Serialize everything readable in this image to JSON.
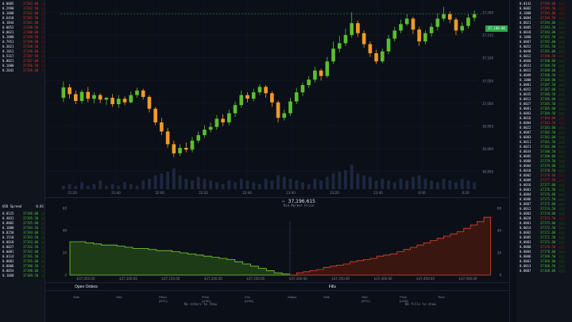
{
  "chart": {
    "price_label": "37,188.00",
    "price_axis": [
      "37,200",
      "37,150",
      "37,100",
      "37,050",
      "37,000",
      "36,950",
      "36,900",
      "36,850"
    ],
    "time_axis": [
      "21:20",
      "21:40",
      "22:00",
      "22:20",
      "22:40",
      "23:00",
      "23:20",
      "23:40",
      "0:00",
      "0:20"
    ],
    "candles": [
      {
        "o": 37012,
        "c": 37035,
        "h": 37048,
        "l": 37003
      },
      {
        "o": 37035,
        "c": 37020,
        "h": 37042,
        "l": 37010
      },
      {
        "o": 37020,
        "c": 37005,
        "h": 37028,
        "l": 36998
      },
      {
        "o": 37005,
        "c": 37025,
        "h": 37030,
        "l": 37000
      },
      {
        "o": 37025,
        "c": 37010,
        "h": 37036,
        "l": 37002
      },
      {
        "o": 37010,
        "c": 37018,
        "h": 37024,
        "l": 37000
      },
      {
        "o": 37018,
        "c": 37008,
        "h": 37022,
        "l": 37000
      },
      {
        "o": 37008,
        "c": 37012,
        "h": 37014,
        "l": 36996
      },
      {
        "o": 37012,
        "c": 36998,
        "h": 37020,
        "l": 36992
      },
      {
        "o": 36998,
        "c": 37010,
        "h": 37018,
        "l": 36990
      },
      {
        "o": 37010,
        "c": 37002,
        "h": 37015,
        "l": 36996
      },
      {
        "o": 37002,
        "c": 37018,
        "h": 37026,
        "l": 37000
      },
      {
        "o": 37018,
        "c": 37028,
        "h": 37034,
        "l": 37012
      },
      {
        "o": 37028,
        "c": 37014,
        "h": 37032,
        "l": 37008
      },
      {
        "o": 37014,
        "c": 36988,
        "h": 37018,
        "l": 36980
      },
      {
        "o": 36988,
        "c": 36958,
        "h": 36992,
        "l": 36952
      },
      {
        "o": 36958,
        "c": 36938,
        "h": 36968,
        "l": 36930
      },
      {
        "o": 36938,
        "c": 36910,
        "h": 36946,
        "l": 36902
      },
      {
        "o": 36910,
        "c": 36890,
        "h": 36918,
        "l": 36882
      },
      {
        "o": 36890,
        "c": 36902,
        "h": 36910,
        "l": 36884
      },
      {
        "o": 36902,
        "c": 36898,
        "h": 36914,
        "l": 36892
      },
      {
        "o": 36898,
        "c": 36918,
        "h": 36926,
        "l": 36892
      },
      {
        "o": 36918,
        "c": 36930,
        "h": 36938,
        "l": 36912
      },
      {
        "o": 36930,
        "c": 36942,
        "h": 36952,
        "l": 36924
      },
      {
        "o": 36942,
        "c": 36948,
        "h": 36958,
        "l": 36936
      },
      {
        "o": 36948,
        "c": 36966,
        "h": 36974,
        "l": 36942
      },
      {
        "o": 36966,
        "c": 36958,
        "h": 36976,
        "l": 36950
      },
      {
        "o": 36958,
        "c": 36978,
        "h": 36986,
        "l": 36952
      },
      {
        "o": 36978,
        "c": 36996,
        "h": 37004,
        "l": 36970
      },
      {
        "o": 36996,
        "c": 37018,
        "h": 37028,
        "l": 36990
      },
      {
        "o": 37018,
        "c": 37010,
        "h": 37024,
        "l": 37002
      },
      {
        "o": 37010,
        "c": 37024,
        "h": 37032,
        "l": 37004
      },
      {
        "o": 37024,
        "c": 37036,
        "h": 37042,
        "l": 37018
      },
      {
        "o": 37036,
        "c": 37022,
        "h": 37040,
        "l": 37012
      },
      {
        "o": 37022,
        "c": 37002,
        "h": 37026,
        "l": 36992
      },
      {
        "o": 37002,
        "c": 36968,
        "h": 37006,
        "l": 36958
      },
      {
        "o": 36968,
        "c": 36978,
        "h": 36986,
        "l": 36962
      },
      {
        "o": 36978,
        "c": 37004,
        "h": 37012,
        "l": 36972
      },
      {
        "o": 37004,
        "c": 37024,
        "h": 37034,
        "l": 36998
      },
      {
        "o": 37024,
        "c": 37040,
        "h": 37046,
        "l": 37016
      },
      {
        "o": 37040,
        "c": 37052,
        "h": 37060,
        "l": 37034
      },
      {
        "o": 37052,
        "c": 37072,
        "h": 37080,
        "l": 37046
      },
      {
        "o": 37072,
        "c": 37060,
        "h": 37076,
        "l": 37050
      },
      {
        "o": 37060,
        "c": 37092,
        "h": 37102,
        "l": 37056
      },
      {
        "o": 37092,
        "c": 37120,
        "h": 37136,
        "l": 37086
      },
      {
        "o": 37120,
        "c": 37132,
        "h": 37148,
        "l": 37112
      },
      {
        "o": 37132,
        "c": 37150,
        "h": 37164,
        "l": 37126
      },
      {
        "o": 37150,
        "c": 37176,
        "h": 37200,
        "l": 37144
      },
      {
        "o": 37176,
        "c": 37154,
        "h": 37182,
        "l": 37146
      },
      {
        "o": 37154,
        "c": 37130,
        "h": 37160,
        "l": 37122
      },
      {
        "o": 37130,
        "c": 37110,
        "h": 37136,
        "l": 37102
      },
      {
        "o": 37110,
        "c": 37092,
        "h": 37118,
        "l": 37086
      },
      {
        "o": 37092,
        "c": 37114,
        "h": 37120,
        "l": 37088
      },
      {
        "o": 37114,
        "c": 37142,
        "h": 37150,
        "l": 37108
      },
      {
        "o": 37142,
        "c": 37160,
        "h": 37168,
        "l": 37136
      },
      {
        "o": 37160,
        "c": 37174,
        "h": 37184,
        "l": 37154
      },
      {
        "o": 37174,
        "c": 37186,
        "h": 37196,
        "l": 37170
      },
      {
        "o": 37186,
        "c": 37162,
        "h": 37190,
        "l": 37152
      },
      {
        "o": 37162,
        "c": 37136,
        "h": 37168,
        "l": 37126
      },
      {
        "o": 37136,
        "c": 37154,
        "h": 37160,
        "l": 37130
      },
      {
        "o": 37154,
        "c": 37168,
        "h": 37176,
        "l": 37146
      },
      {
        "o": 37168,
        "c": 37186,
        "h": 37198,
        "l": 37160
      },
      {
        "o": 37186,
        "c": 37196,
        "h": 37212,
        "l": 37180
      },
      {
        "o": 37196,
        "c": 37184,
        "h": 37202,
        "l": 37176
      },
      {
        "o": 37184,
        "c": 37160,
        "h": 37188,
        "l": 37150
      },
      {
        "o": 37160,
        "c": 37170,
        "h": 37178,
        "l": 37154
      },
      {
        "o": 37170,
        "c": 37188,
        "h": 37196,
        "l": 37164
      },
      {
        "o": 37188,
        "c": 37196,
        "h": 37204,
        "l": 37180
      }
    ],
    "volumes": [
      2,
      3,
      2,
      4,
      2,
      3,
      5,
      2,
      3,
      2,
      4,
      3,
      2,
      5,
      6,
      8,
      9,
      10,
      12,
      8,
      6,
      5,
      7,
      6,
      5,
      4,
      3,
      5,
      4,
      6,
      5,
      4,
      3,
      6,
      5,
      8,
      7,
      6,
      5,
      4,
      3,
      6,
      5,
      7,
      9,
      10,
      11,
      14,
      9,
      8,
      7,
      5,
      6,
      5,
      4,
      6,
      5,
      7,
      8,
      6,
      5,
      4,
      6,
      5,
      4,
      6,
      5,
      4
    ]
  },
  "depth": {
    "mid_price": "37,196.615",
    "mid_label": "Mid Market Price",
    "x_ticks": [
      "$37,050.00",
      "$37,100.00",
      "$37,150.00",
      "$37,200.00",
      "$37,250.00",
      "$37,300.00",
      "$37,350.00",
      "$37,400.00",
      "$37,450.00",
      "$37,500.00"
    ],
    "y_left": [
      "60",
      "40",
      "20",
      "0"
    ],
    "y_right": [
      "60",
      "40",
      "20",
      "0"
    ],
    "bids": [
      30,
      30,
      29,
      28,
      27,
      27,
      26,
      25,
      24,
      24,
      23,
      22,
      22,
      21,
      20,
      19,
      18,
      17,
      16,
      15,
      14,
      12,
      10,
      8,
      6,
      4,
      2,
      1,
      0
    ],
    "asks": [
      0,
      2,
      3,
      4,
      5,
      7,
      8,
      9,
      10,
      12,
      13,
      14,
      15,
      17,
      18,
      19,
      21,
      23,
      25,
      27,
      29,
      31,
      33,
      35,
      37,
      39,
      42,
      45,
      48,
      52
    ]
  },
  "orders": {
    "left_title": "Open Orders",
    "right_title": "Fills",
    "left_headers": [
      "Side",
      "Size",
      "Filled (BTC)",
      "Price (USD)",
      "Fee (USD)",
      "Status"
    ],
    "right_headers": [
      "Side",
      "Size (BTC)",
      "Price (USD)",
      "Time"
    ],
    "left_empty": "No orders to show",
    "right_empty": "No fills to show"
  },
  "left_orderbook": {
    "usd_label": "USD Spread",
    "usd_value": "0.01",
    "asks": [
      {
        "size": "0.0005",
        "price": "37203.00"
      },
      {
        "size": "0.2990",
        "price": "37202.50"
      },
      {
        "size": "0.1000",
        "price": "37202.00"
      },
      {
        "size": "0.6410",
        "price": "37201.50"
      },
      {
        "size": "0.1844",
        "price": "37201.00"
      },
      {
        "size": "0.0052",
        "price": "37200.50"
      },
      {
        "size": "0.0021",
        "price": "37200.00"
      },
      {
        "size": "0.1000",
        "price": "37199.50"
      },
      {
        "size": "0.7951",
        "price": "37199.00"
      },
      {
        "size": "0.3021",
        "price": "37198.50"
      },
      {
        "size": "0.1011",
        "price": "37198.00"
      },
      {
        "size": "0.5317",
        "price": "37197.50"
      },
      {
        "size": "0.0021",
        "price": "37197.00"
      },
      {
        "size": "0.1000",
        "price": "37196.50"
      },
      {
        "size": "0.2042",
        "price": "37196.00"
      }
    ],
    "bids": [
      {
        "size": "0.0125",
        "price": "37196.00"
      },
      {
        "size": "0.4031",
        "price": "37195.50"
      },
      {
        "size": "0.0002",
        "price": "37195.00"
      },
      {
        "size": "0.1000",
        "price": "37194.50"
      },
      {
        "size": "0.0258",
        "price": "37194.00"
      },
      {
        "size": "0.1510",
        "price": "37193.50"
      },
      {
        "size": "0.0010",
        "price": "37193.00"
      },
      {
        "size": "0.0027",
        "price": "37192.50"
      },
      {
        "size": "0.0001",
        "price": "37192.00"
      },
      {
        "size": "0.0114",
        "price": "37191.50"
      },
      {
        "size": "0.0003",
        "price": "37191.00"
      },
      {
        "size": "0.0006",
        "price": "37190.50"
      },
      {
        "size": "0.0054",
        "price": "37190.00"
      },
      {
        "size": "0.1060",
        "price": "37189.50"
      }
    ]
  },
  "right_orderbook": {
    "rows": [
      {
        "size": "0.0143",
        "price": "37196.00",
        "c": "red"
      },
      {
        "size": "0.0002",
        "price": "37195.50",
        "c": "red"
      },
      {
        "size": "0.1000",
        "price": "37195.00",
        "c": "red"
      },
      {
        "size": "0.0004",
        "price": "37194.50",
        "c": "red"
      },
      {
        "size": "0.0021",
        "price": "37194.00",
        "c": "green"
      },
      {
        "size": "0.0005",
        "price": "37193.50",
        "c": "green"
      },
      {
        "size": "0.0018",
        "price": "37193.00",
        "c": "green"
      },
      {
        "size": "0.1000",
        "price": "37192.50",
        "c": "green"
      },
      {
        "size": "0.0007",
        "price": "37192.00",
        "c": "green"
      },
      {
        "size": "0.0052",
        "price": "37191.50",
        "c": "green"
      },
      {
        "size": "0.0040",
        "price": "37191.00",
        "c": "green"
      },
      {
        "size": "0.0012",
        "price": "37190.50",
        "c": "red"
      },
      {
        "size": "0.0060",
        "price": "37190.00",
        "c": "green"
      },
      {
        "size": "0.0031",
        "price": "37189.50",
        "c": "green"
      },
      {
        "size": "0.0015",
        "price": "37189.00",
        "c": "green"
      },
      {
        "size": "0.0009",
        "price": "37188.50",
        "c": "green"
      },
      {
        "size": "0.1000",
        "price": "37188.00",
        "c": "green"
      },
      {
        "size": "0.0001",
        "price": "37187.50",
        "c": "green"
      },
      {
        "size": "0.0052",
        "price": "37187.00",
        "c": "green"
      },
      {
        "size": "0.0035",
        "price": "37186.50",
        "c": "green"
      },
      {
        "size": "0.0012",
        "price": "37186.00",
        "c": "green"
      },
      {
        "size": "0.0027",
        "price": "37185.50",
        "c": "green"
      },
      {
        "size": "0.0001",
        "price": "37185.00",
        "c": "green"
      },
      {
        "size": "0.0003",
        "price": "37184.50",
        "c": "green"
      },
      {
        "size": "0.0016",
        "price": "37184.00",
        "c": "red"
      },
      {
        "size": "0.0004",
        "price": "37183.50",
        "c": "red"
      },
      {
        "size": "0.0022",
        "price": "37183.00",
        "c": "green"
      },
      {
        "size": "0.0007",
        "price": "37182.50",
        "c": "green"
      },
      {
        "size": "0.0003",
        "price": "37182.00",
        "c": "green"
      },
      {
        "size": "0.0011",
        "price": "37181.50",
        "c": "green"
      },
      {
        "size": "0.0021",
        "price": "37181.00",
        "c": "green"
      },
      {
        "size": "0.0034",
        "price": "37180.50",
        "c": "green"
      },
      {
        "size": "0.0005",
        "price": "37180.00",
        "c": "green"
      },
      {
        "size": "0.0008",
        "price": "37179.50",
        "c": "green"
      },
      {
        "size": "0.0004",
        "price": "37179.00",
        "c": "green"
      },
      {
        "size": "0.0010",
        "price": "37178.50",
        "c": "green"
      },
      {
        "size": "0.0002",
        "price": "37178.00",
        "c": "red"
      },
      {
        "size": "0.0009",
        "price": "37177.50",
        "c": "red"
      },
      {
        "size": "0.0016",
        "price": "37177.00",
        "c": "green"
      },
      {
        "size": "0.0001",
        "price": "37176.50",
        "c": "green"
      },
      {
        "size": "0.0004",
        "price": "37176.00",
        "c": "green"
      },
      {
        "size": "0.0006",
        "price": "37175.50",
        "c": "green"
      },
      {
        "size": "0.0007",
        "price": "37175.00",
        "c": "green"
      },
      {
        "size": "0.0012",
        "price": "37174.50",
        "c": "green"
      },
      {
        "size": "0.0003",
        "price": "37174.00",
        "c": "green"
      },
      {
        "size": "0.0020",
        "price": "37173.50",
        "c": "red"
      },
      {
        "size": "0.0001",
        "price": "37173.00",
        "c": "green"
      },
      {
        "size": "0.0014",
        "price": "37172.50",
        "c": "green"
      },
      {
        "size": "0.0002",
        "price": "37172.00",
        "c": "green"
      },
      {
        "size": "0.0005",
        "price": "37171.50",
        "c": "green"
      },
      {
        "size": "0.0003",
        "price": "37171.00",
        "c": "green"
      },
      {
        "size": "0.0008",
        "price": "37170.50",
        "c": "red"
      },
      {
        "size": "0.0004",
        "price": "37170.00",
        "c": "green"
      },
      {
        "size": "0.0006",
        "price": "37169.50",
        "c": "green"
      },
      {
        "size": "0.0001",
        "price": "37169.00",
        "c": "green"
      },
      {
        "size": "0.0013",
        "price": "37168.50",
        "c": "green"
      },
      {
        "size": "0.0007",
        "price": "37168.00",
        "c": "green"
      }
    ]
  }
}
